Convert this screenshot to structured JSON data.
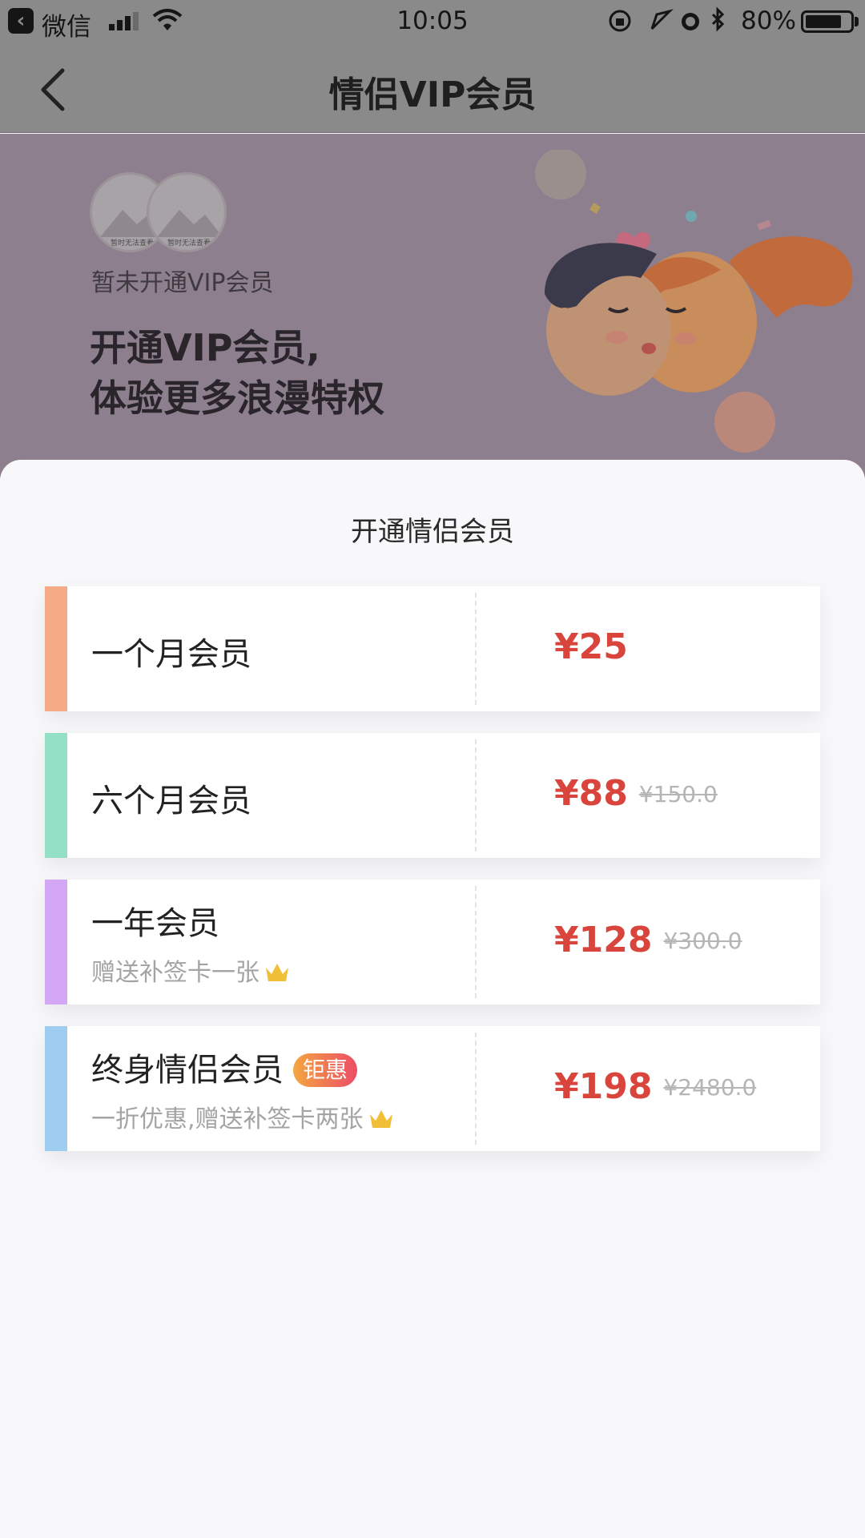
{
  "status_bar": {
    "carrier": "微信",
    "time": "10:05",
    "battery": "80%"
  },
  "nav": {
    "title": "情侣VIP会员"
  },
  "hero": {
    "status": "暂未开通VIP会员",
    "promo_line1": "开通VIP会员,",
    "promo_line2": "体验更多浪漫特权",
    "avatar_placeholder": "暂时无法查看"
  },
  "sheet": {
    "title": "开通情侣会员",
    "plans": [
      {
        "name": "一个月会员",
        "price": "¥25",
        "original_price": "",
        "subtitle": "",
        "badge": "",
        "accent": "#f5ac86"
      },
      {
        "name": "六个月会员",
        "price": "¥88",
        "original_price": "¥150.0",
        "subtitle": "",
        "badge": "",
        "accent": "#94e0c6"
      },
      {
        "name": "一年会员",
        "price": "¥128",
        "original_price": "¥300.0",
        "subtitle": "赠送补签卡一张",
        "badge": "",
        "accent": "#d3a7f6"
      },
      {
        "name": "终身情侣会员",
        "price": "¥198",
        "original_price": "¥2480.0",
        "subtitle": "一折优惠,赠送补签卡两张",
        "badge": "钜惠",
        "accent": "#9fcdf1"
      }
    ]
  },
  "colors": {
    "price": "#d9453c",
    "overlay": "#8a8a8a"
  }
}
